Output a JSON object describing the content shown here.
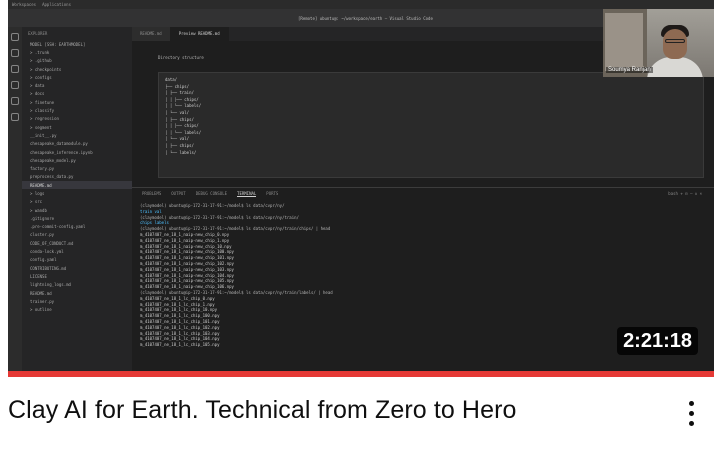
{
  "video": {
    "title": "Clay AI for Earth. Technical from Zero to Hero",
    "duration": "2:21:18",
    "progress_fraction": 1.0,
    "progress_color": "#e53935",
    "more_icon": "vertical-ellipsis-icon"
  },
  "thumbnail": {
    "menubar": [
      "Workspaces",
      "Applications"
    ],
    "window_title": "[Remote] ubuntu@: ~/workspace/earth — Visual Studio Code",
    "explorer": {
      "header": "EXPLORER",
      "items": [
        "MODEL [SSH: EARTHMODEL]",
        "> .trunk",
        "> .github",
        "> checkpoints",
        "> configs",
        "> data",
        "> docs",
        "> finetune",
        "> classify",
        "> regression",
        "> segment",
        "__init__.py",
        "chesapeake_datamodule.py",
        "chesapeake_inference.ipynb",
        "chesapeake_model.py",
        "factory.py",
        "preprocess_data.py",
        "README.md",
        "> logs",
        "> src",
        "> wandb",
        ".gitignore",
        ".pre-commit-config.yaml",
        "cluster.py",
        "CODE_OF_CONDUCT.md",
        "conda-lock.yml",
        "config.yaml",
        "CONTRIBUTING.md",
        "LICENSE",
        "lightning_logs.md",
        "README.md",
        "trainer.py",
        "> outline"
      ],
      "selected_index": 17
    },
    "editor": {
      "tabs": [
        "README.md",
        "Preview README.md"
      ],
      "active_tab": 1,
      "breadcrumb": "Directory structure",
      "code_lines": [
        "data/",
        "├── chips/",
        "│   ├── train/",
        "│   │   ├── chips/",
        "│   │   └── labels/",
        "│   └── val/",
        "│       ├── chips/",
        "│       │   ├── chips/",
        "│       │   └── labels/",
        "│       └── val/",
        "│           ├── chips/",
        "│           └── labels/"
      ]
    },
    "panel": {
      "tabs": [
        "PROBLEMS",
        "OUTPUT",
        "DEBUG CONSOLE",
        "TERMINAL",
        "PORTS"
      ],
      "active_tab": 3,
      "controls": "bash  +  ⊟  ⋯  ∧  ×",
      "terminal_lines": [
        {
          "kind": "cmd",
          "text": "(claymodel) ubuntu@ip-172-31-17-91:~/model$ ls data/cvpr/ny/"
        },
        {
          "kind": "hl",
          "text": "train  val"
        },
        {
          "kind": "cmd",
          "text": "(claymodel) ubuntu@ip-172-31-17-91:~/model$ ls data/cvpr/ny/train/"
        },
        {
          "kind": "hl",
          "text": "chips  labels"
        },
        {
          "kind": "cmd",
          "text": "(claymodel) ubuntu@ip-172-31-17-91:~/model$ ls data/cvpr/ny/train/chips/ | head"
        },
        {
          "kind": "out",
          "text": "m_4107407_ne_18_1_naip-new_chip_0.npy"
        },
        {
          "kind": "out",
          "text": "m_4107407_ne_18_1_naip-new_chip_1.npy"
        },
        {
          "kind": "out",
          "text": "m_4107407_ne_18_1_naip-new_chip_10.npy"
        },
        {
          "kind": "out",
          "text": "m_4107407_ne_18_1_naip-new_chip_100.npy"
        },
        {
          "kind": "out",
          "text": "m_4107407_ne_18_1_naip-new_chip_101.npy"
        },
        {
          "kind": "out",
          "text": "m_4107407_ne_18_1_naip-new_chip_102.npy"
        },
        {
          "kind": "out",
          "text": "m_4107407_ne_18_1_naip-new_chip_103.npy"
        },
        {
          "kind": "out",
          "text": "m_4107407_ne_18_1_naip-new_chip_104.npy"
        },
        {
          "kind": "out",
          "text": "m_4107407_ne_18_1_naip-new_chip_105.npy"
        },
        {
          "kind": "out",
          "text": "m_4107407_ne_18_1_naip-new_chip_106.npy"
        },
        {
          "kind": "cmd",
          "text": "(claymodel) ubuntu@ip-172-31-17-91:~/model$ ls data/cvpr/ny/train/labels/ | head"
        },
        {
          "kind": "out",
          "text": "m_4107407_ne_18_1_lc_chip_0.npy"
        },
        {
          "kind": "out",
          "text": "m_4107407_ne_18_1_lc_chip_1.npy"
        },
        {
          "kind": "out",
          "text": "m_4107407_ne_18_1_lc_chip_10.npy"
        },
        {
          "kind": "out",
          "text": "m_4107407_ne_18_1_lc_chip_100.npy"
        },
        {
          "kind": "out",
          "text": "m_4107407_ne_18_1_lc_chip_101.npy"
        },
        {
          "kind": "out",
          "text": "m_4107407_ne_18_1_lc_chip_102.npy"
        },
        {
          "kind": "out",
          "text": "m_4107407_ne_18_1_lc_chip_103.npy"
        },
        {
          "kind": "out",
          "text": "m_4107407_ne_18_1_lc_chip_104.npy"
        },
        {
          "kind": "out",
          "text": "m_4107407_ne_18_1_lc_chip_105.npy"
        }
      ]
    },
    "webcam_name": "Soumya Ranjan"
  }
}
